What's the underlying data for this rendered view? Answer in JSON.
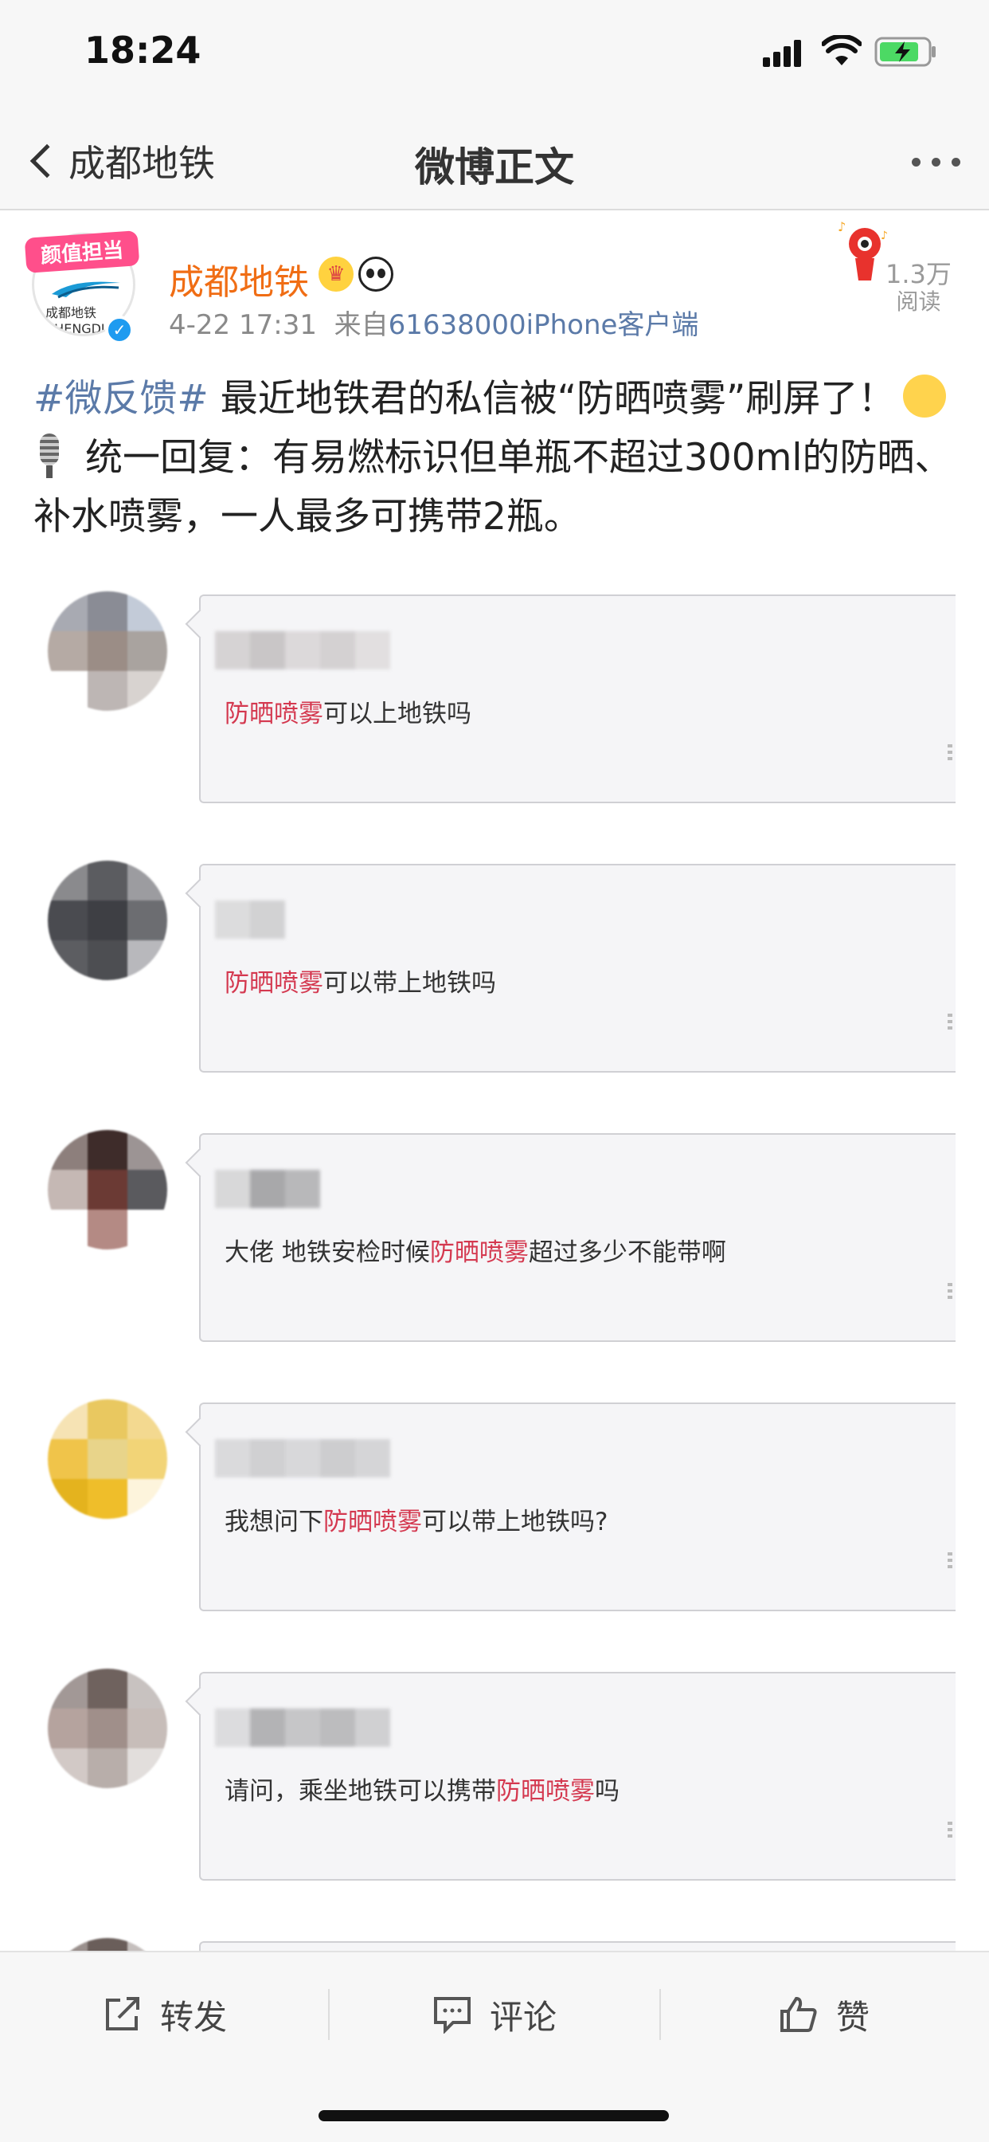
{
  "status_bar": {
    "time": "18:24"
  },
  "nav": {
    "back_label": "成都地铁",
    "title": "微博正文"
  },
  "post": {
    "avatar_badge": "颜值担当",
    "username": "成都地铁",
    "date": "4-22 17:31",
    "source_prefix": "来自",
    "source": "61638000iPhone客户端",
    "reads_count": "1.3万",
    "reads_label": "阅读",
    "hashtag": "#微反馈#",
    "text_line1": " 最近地铁君的私信被“防晒喷雾”刷屏了！",
    "text_line2": " 统一回复：有易燃标识但单瓶不超过300ml的防晒、补水喷雾，一人最多可携带2瓶。"
  },
  "messages": [
    {
      "pre": "",
      "hl": "防晒喷雾",
      "post": "可以上地铁吗"
    },
    {
      "pre": "",
      "hl": "防晒喷雾",
      "post": "可以带上地铁吗"
    },
    {
      "pre": "大佬 地铁安检时候",
      "hl": "防晒喷雾",
      "post": "超过多少不能带啊"
    },
    {
      "pre": "我想问下",
      "hl": "防晒喷雾",
      "post": "可以带上地铁吗?"
    },
    {
      "pre": "请问，乘坐地铁可以携带",
      "hl": "防晒喷雾",
      "post": "吗"
    }
  ],
  "toolbar": {
    "repost": "转发",
    "comment": "评论",
    "like": "赞"
  },
  "colors": {
    "accent_orange": "#f06d14",
    "link_blue": "#5b7aa8",
    "highlight_red": "#d4384f"
  }
}
